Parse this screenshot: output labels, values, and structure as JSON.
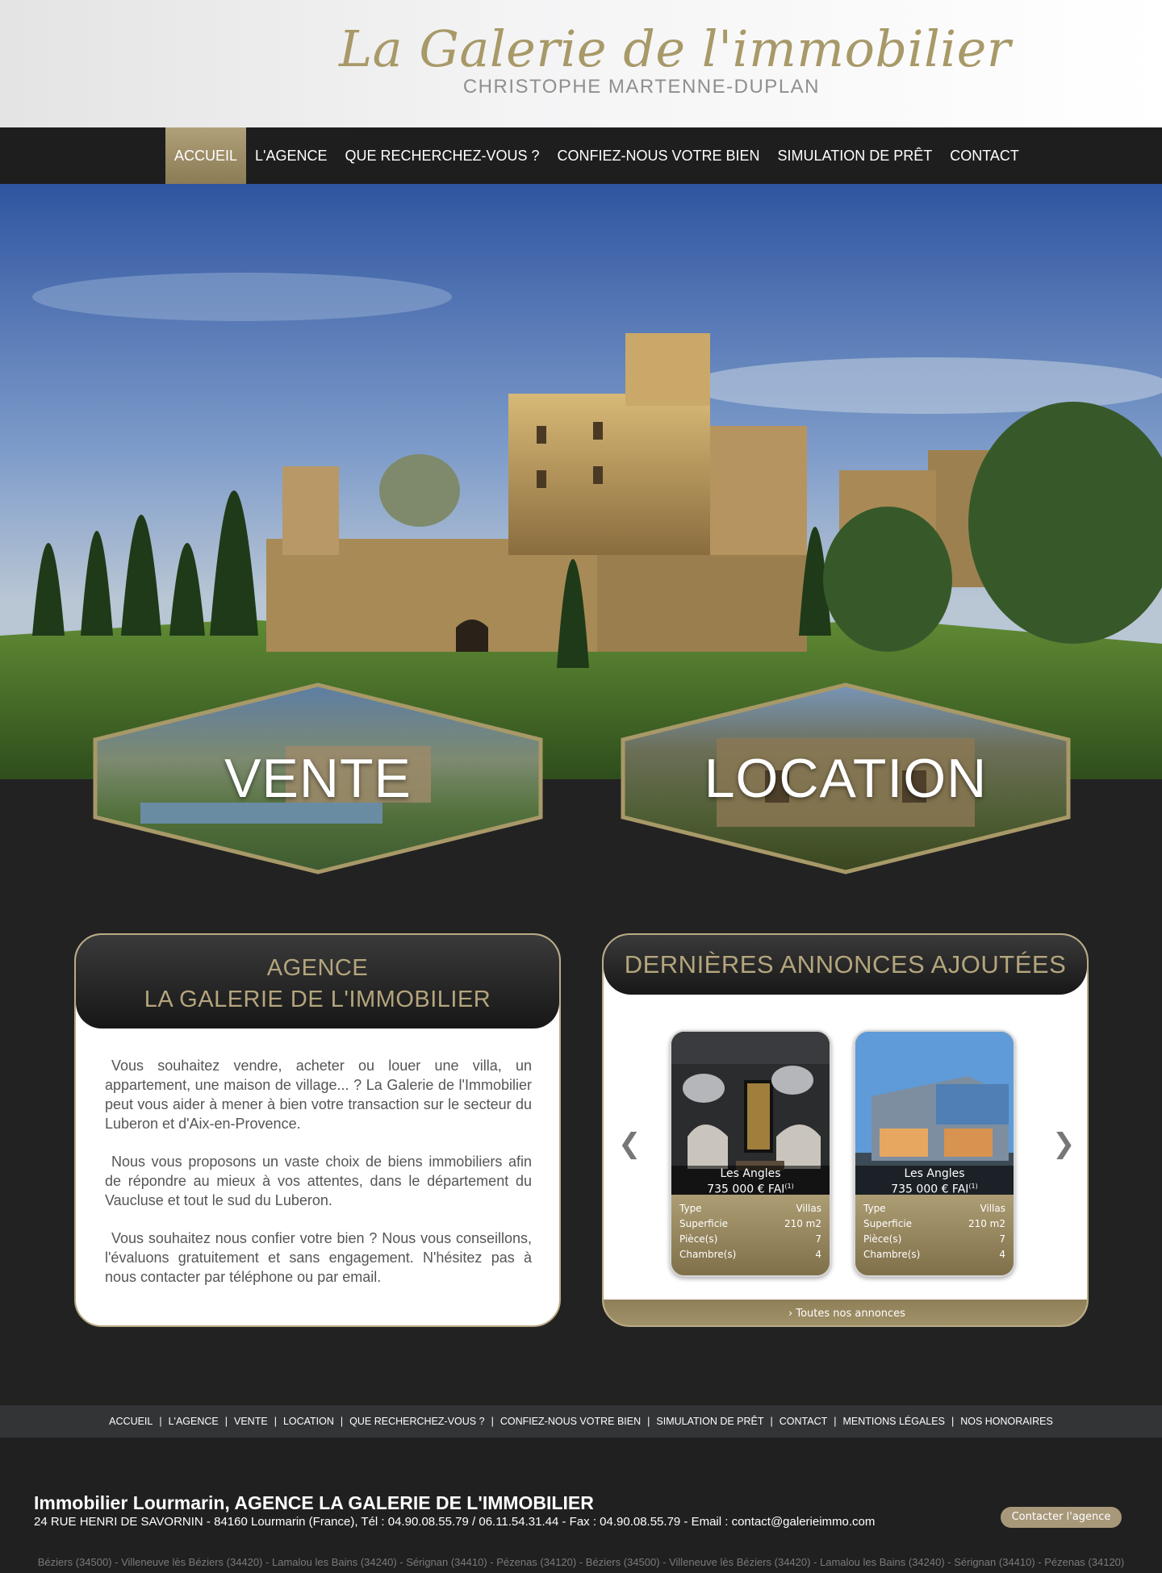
{
  "header": {
    "logo_script": "La Galerie de l'immobilier",
    "logo_sub": "CHRISTOPHE MARTENNE-DUPLAN"
  },
  "nav": {
    "items": [
      {
        "label": "ACCUEIL",
        "active": true
      },
      {
        "label": "L'AGENCE"
      },
      {
        "label": "QUE RECHERCHEZ-VOUS ?"
      },
      {
        "label": "CONFIEZ-NOUS VOTRE BIEN"
      },
      {
        "label": "SIMULATION DE PRÊT"
      },
      {
        "label": "CONTACT"
      }
    ]
  },
  "hero": {
    "vente_label": "VENTE",
    "location_label": "LOCATION"
  },
  "agence": {
    "title_line1": "AGENCE",
    "title_line2": "LA GALERIE DE L'IMMOBILIER",
    "paragraphs": [
      "Vous souhaitez vendre, acheter ou louer une villa, un appartement, une maison de village... ? La Galerie de l'Immobilier peut vous aider à mener à bien votre transaction sur le secteur du Luberon et d'Aix-en-Provence.",
      "Nous vous proposons un vaste choix de biens immobiliers afin de répondre au mieux à vos attentes, dans le département du Vaucluse et tout le sud du Luberon.",
      "Vous souhaitez nous confier votre bien ? Nous vous conseillons, l'évaluons gratuitement et sans engagement. N'hésitez pas à nous contacter par téléphone ou par email."
    ]
  },
  "annonces": {
    "title": "DERNIÈRES ANNONCES AJOUTÉES",
    "prev_icon": "❮",
    "next_icon": "❯",
    "footer_link": "Toutes nos annonces",
    "footer_icon": "›",
    "cards": [
      {
        "city": "Les Angles",
        "price": "735 000 € FAI",
        "price_note": "(1)",
        "specs": [
          {
            "label": "Type",
            "value": "Villas"
          },
          {
            "label": "Superficie",
            "value": "210 m2"
          },
          {
            "label": "Pièce(s)",
            "value": "7"
          },
          {
            "label": "Chambre(s)",
            "value": "4"
          }
        ]
      },
      {
        "city": "Les Angles",
        "price": "735 000 € FAI",
        "price_note": "(1)",
        "specs": [
          {
            "label": "Type",
            "value": "Villas"
          },
          {
            "label": "Superficie",
            "value": "210 m2"
          },
          {
            "label": "Pièce(s)",
            "value": "7"
          },
          {
            "label": "Chambre(s)",
            "value": "4"
          }
        ]
      }
    ]
  },
  "footer_nav": {
    "items": [
      "ACCUEIL",
      "L'AGENCE",
      "VENTE",
      "LOCATION",
      "QUE RECHERCHEZ-VOUS ?",
      "CONFIEZ-NOUS VOTRE BIEN",
      "SIMULATION DE PRÊT",
      "CONTACT",
      "MENTIONS LÉGALES",
      "NOS HONORAIRES"
    ],
    "separator": "|"
  },
  "footer": {
    "title": "Immobilier Lourmarin, AGENCE LA GALERIE DE L'IMMOBILIER",
    "address": "24 RUE HENRI DE SAVORNIN - 84160 Lourmarin (France), Tél : 04.90.08.55.79 / 06.11.54.31.44 - Fax : 04.90.08.55.79 - Email : contact@galerieimmo.com",
    "contact_button": "Contacter l'agence",
    "cities": "Béziers (34500) - Villeneuve lès Béziers (34420) - Lamalou les Bains (34240) - Sérignan (34410) - Pézenas (34120) - Béziers (34500) - Villeneuve lès Béziers (34420) - Lamalou les Bains (34240) - Sérignan (34410) - Pézenas (34120)"
  },
  "colors": {
    "gold": "#a89968",
    "dark": "#1f1f20",
    "panel_border": "#b9ab84"
  }
}
